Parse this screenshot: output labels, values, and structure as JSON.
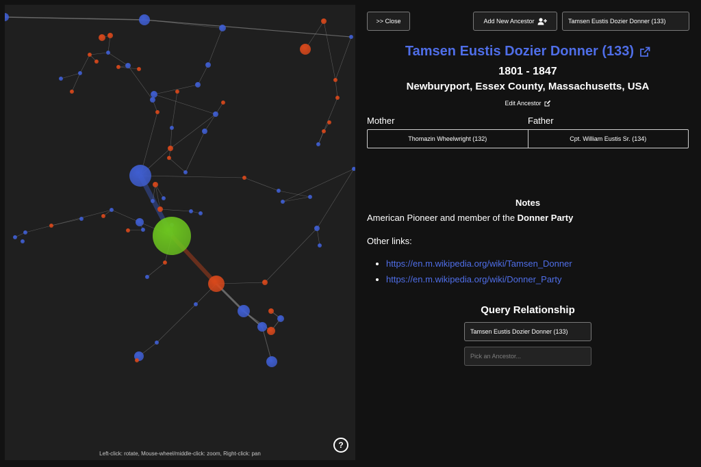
{
  "graph": {
    "hint": "Left-click: rotate, Mouse-wheel/middle-click: zoom, Right-click: pan",
    "help_label": "?",
    "colors": {
      "male": "#3f5ed1",
      "female": "#d8481b",
      "selected": "#6cc41f",
      "link": "#8a8a8a",
      "background": "#1f1f1f"
    }
  },
  "toolbar": {
    "close_label": ">> Close",
    "add_label": "Add New Ancestor",
    "search_value": "Tamsen Eustis Dozier Donner (133)"
  },
  "person": {
    "name": "Tamsen Eustis Dozier Donner (133)",
    "dates": "1801 - 1847",
    "place": "Newburyport, Essex County, Massachusetts, USA",
    "edit_label": "Edit Ancestor"
  },
  "parents": {
    "mother_label": "Mother",
    "father_label": "Father",
    "mother": "Thomazin Wheelwright (132)",
    "father": "Cpt. William Eustis Sr. (134)"
  },
  "notes": {
    "heading": "Notes",
    "text_prefix": "American Pioneer and member of the ",
    "text_bold": "Donner Party",
    "other_links_label": "Other links:",
    "links": [
      "https://en.m.wikipedia.org/wiki/Tamsen_Donner",
      "https://en.m.wikipedia.org/wiki/Donner_Party"
    ]
  },
  "query": {
    "heading": "Query Relationship",
    "from_value": "Tamsen Eustis Dozier Donner (133)",
    "to_placeholder": "Pick an Ancestor..."
  }
}
